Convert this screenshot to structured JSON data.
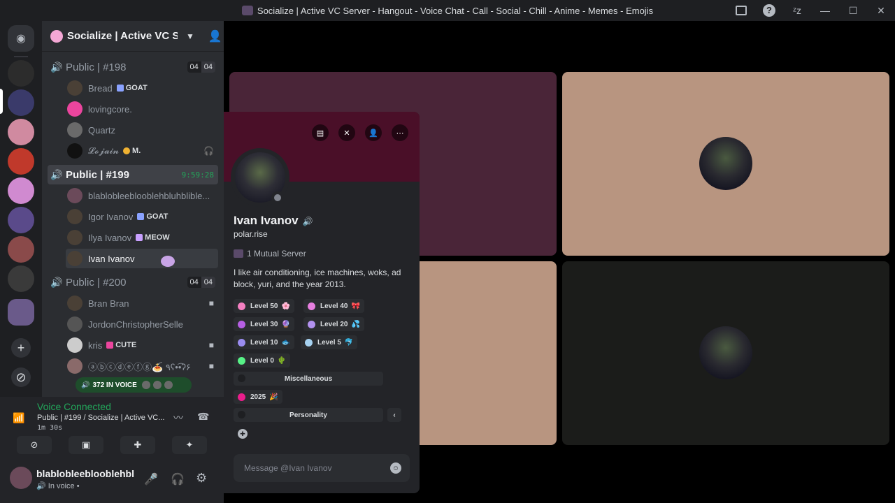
{
  "window": {
    "title": "Socialize | Active VC Server - Hangout - Voice Chat - Call - Social - Chill - Anime - Memes - Emojis",
    "icons": [
      "inbox-icon",
      "help-icon",
      "sleep-icon",
      "minimize-icon",
      "maximize-icon",
      "close-icon"
    ]
  },
  "guild": {
    "name": "Socialize | Active VC Server - Hangout - Voice Chat - Call - Social - Chill - Anime - Memes - Emojis"
  },
  "channels": [
    {
      "name": "Public | #198",
      "count_a": "04",
      "count_b": "04",
      "active": false,
      "users": [
        {
          "name": "Bread",
          "tag": "GOAT",
          "tag_color": "#8aa2ff"
        },
        {
          "name": "lovingcore.",
          "tag": "",
          "avatar_color": "#eb459e"
        },
        {
          "name": "Quartz",
          "tag": ""
        },
        {
          "name": "𝓛𝓸𝓳𝓪𝓲𝓷",
          "tag": "M.",
          "tag_color": "#f0b232"
        }
      ]
    },
    {
      "name": "Public | #199",
      "timer": "9:59:28",
      "active": true,
      "users": [
        {
          "name": "blablobleeblooblehbluhblible..."
        },
        {
          "name": "Igor Ivanov",
          "tag": "GOAT",
          "tag_color": "#8aa2ff"
        },
        {
          "name": "Ilya Ivanov",
          "tag": "MEOW",
          "tag_color": "#c9a0ff"
        },
        {
          "name": "Ivan Ivanov"
        }
      ]
    },
    {
      "name": "Public | #200",
      "count_a": "04",
      "count_b": "04",
      "active": false,
      "users": [
        {
          "name": "Bran Bran"
        },
        {
          "name": "JordonChristopherSelle"
        },
        {
          "name": "kris",
          "tag": "CUTE",
          "tag_color": "#eb459e"
        },
        {
          "name": "ⓐⓑⓒⓓⓔⓕⓖ🍝 ٩ʕ•͡•ʔ۶"
        }
      ]
    }
  ],
  "in_voice_pill": "372 IN VOICE",
  "voice_panel": {
    "title": "Voice Connected",
    "sub": "Public | #199 / Socialize | Active VC...",
    "time": "1m 30s"
  },
  "user_panel": {
    "name": "blablobleeblooblehbluhblible",
    "status": "In voice •"
  },
  "profile": {
    "display_name": "Ivan Ivanov",
    "username": "polar.rise",
    "mutual": "1 Mutual Server",
    "bio": "I like air conditioning, ice machines, woks, ad block, yuri, and the year 2013.",
    "roles": [
      {
        "label": "Level 50",
        "color": "#f47fc1",
        "emoji": "🌸"
      },
      {
        "label": "Level 40",
        "color": "#e77fe0",
        "emoji": "🎀"
      },
      {
        "label": "Level 30",
        "color": "#b65fe4",
        "emoji": "🔮"
      },
      {
        "label": "Level 20",
        "color": "#b392f0",
        "emoji": "💦"
      },
      {
        "label": "Level 10",
        "color": "#9a8cf0",
        "emoji": "🐟"
      },
      {
        "label": "Level 5",
        "color": "#a6d1f0",
        "emoji": "🐬"
      },
      {
        "label": "Level 0",
        "color": "#57f287",
        "emoji": "🌵"
      },
      {
        "label": "Miscellaneous",
        "color": "#232428"
      },
      {
        "label": "2025",
        "color": "#eb1e8c",
        "emoji": "🎉"
      },
      {
        "label": "Personality",
        "color": "#232428"
      }
    ],
    "message_placeholder": "Message @Ivan Ivanov"
  },
  "colors": {
    "accent_green": "#23a55a",
    "banner": "#4a0f28",
    "tile_purple": "#4a2538",
    "tile_tan": "#b89580",
    "tile_dark": "#1b1c1a"
  }
}
